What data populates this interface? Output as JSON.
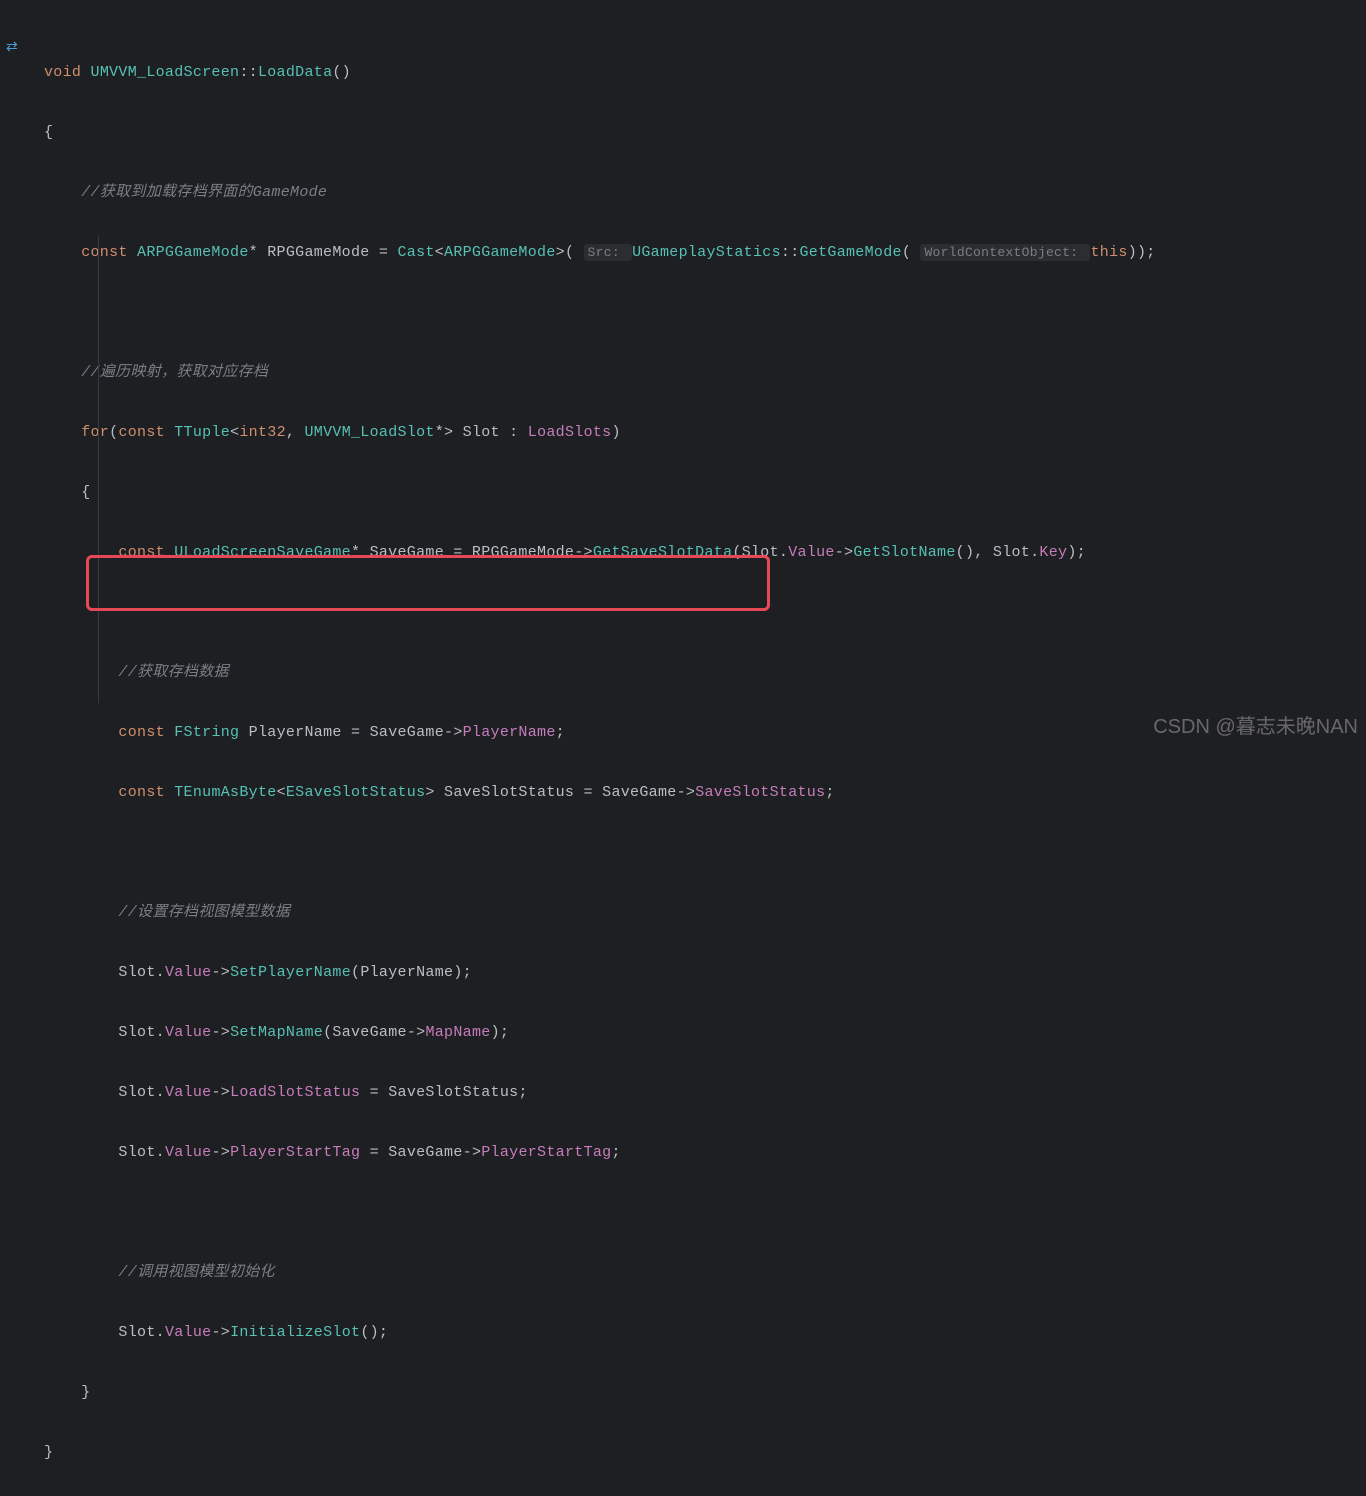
{
  "code": {
    "l1": {
      "kw_void": "void ",
      "class": "UMVVM_LoadScreen",
      "scope": "::",
      "fn": "LoadData",
      "paren": "()"
    },
    "l2": "{",
    "l3": "    //获取到加载存档界面的GameMode",
    "l4": {
      "kw_const": "    const ",
      "type1": "ARPGGameMode",
      "ptr": "* ",
      "var": "RPGGameMode",
      "eq": " = ",
      "cast": "Cast",
      "lt": "<",
      "type2": "ARPGGameMode",
      "gt": ">( ",
      "hint1": "Src: ",
      "cls": "UGameplayStatics",
      "scope2": "::",
      "fn2": "GetGameMode",
      "paren2": "( ",
      "hint2": "WorldContextObject: ",
      "this": "this",
      "end": "));"
    },
    "l5": "    //遍历映射，获取对应存档",
    "l6": {
      "kw_for": "    for",
      "p1": "(",
      "kw_const": "const ",
      "ttuple": "TTuple",
      "lt": "<",
      "int32": "int32",
      "comma": ", ",
      "mvvm": "UMVVM_LoadSlot",
      "ptr": "*> ",
      "slot": "Slot",
      "colon": " : ",
      "loadslots": "LoadSlots",
      "p2": ")"
    },
    "l7": "    {",
    "l8": {
      "indent": "        ",
      "kw_const": "const ",
      "type": "ULoadScreenSaveGame",
      "ptr": "* ",
      "var": "SaveGame",
      "eq": " = ",
      "rpg": "RPGGameMode",
      "arrow": "->",
      "fn": "GetSaveSlotData",
      "p1": "(",
      "slot": "Slot",
      "dot": ".",
      "val": "Value",
      "arrow2": "->",
      "fn2": "GetSlotName",
      "p2": "(), ",
      "slot2": "Slot",
      "dot2": ".",
      "key": "Key",
      "p3": ");"
    },
    "l9": "        //获取存档数据",
    "l10": {
      "indent": "        ",
      "kw": "const ",
      "type": "FString",
      "sp": " ",
      "var": "PlayerName",
      "eq": " = ",
      "sg": "SaveGame",
      "arrow": "->",
      "mem": "PlayerName",
      "semi": ";"
    },
    "l11": {
      "indent": "        ",
      "kw": "const ",
      "type": "TEnumAsByte",
      "lt": "<",
      "enum": "ESaveSlotStatus",
      "gt": "> ",
      "var": "SaveSlotStatus",
      "eq": " = ",
      "sg": "SaveGame",
      "arrow": "->",
      "mem": "SaveSlotStatus",
      "semi": ";"
    },
    "l12": "        //设置存档视图模型数据",
    "l13": {
      "indent": "        ",
      "slot": "Slot",
      "dot": ".",
      "val": "Value",
      "arrow": "->",
      "fn": "SetPlayerName",
      "p1": "(",
      "arg": "PlayerName",
      "p2": ");"
    },
    "l14": {
      "indent": "        ",
      "slot": "Slot",
      "dot": ".",
      "val": "Value",
      "arrow": "->",
      "fn": "SetMapName",
      "p1": "(",
      "sg": "SaveGame",
      "arrow2": "->",
      "mem": "MapName",
      "p2": ");"
    },
    "l15": {
      "indent": "        ",
      "slot": "Slot",
      "dot": ".",
      "val": "Value",
      "arrow": "->",
      "mem": "LoadSlotStatus",
      "eq": " = ",
      "var": "SaveSlotStatus",
      "semi": ";"
    },
    "l16": {
      "indent": "        ",
      "slot": "Slot",
      "dot": ".",
      "val": "Value",
      "arrow": "->",
      "mem": "PlayerStartTag",
      "eq": " = ",
      "sg": "SaveGame",
      "arrow2": "->",
      "mem2": "PlayerStartTag",
      "semi": ";"
    },
    "l17": "        //调用视图模型初始化",
    "l18": {
      "indent": "        ",
      "slot": "Slot",
      "dot": ".",
      "val": "Value",
      "arrow": "->",
      "fn": "InitializeSlot",
      "p": "();"
    },
    "l19": "    }",
    "l20": "}"
  },
  "watermark": "CSDN @暮志未晚NAN"
}
